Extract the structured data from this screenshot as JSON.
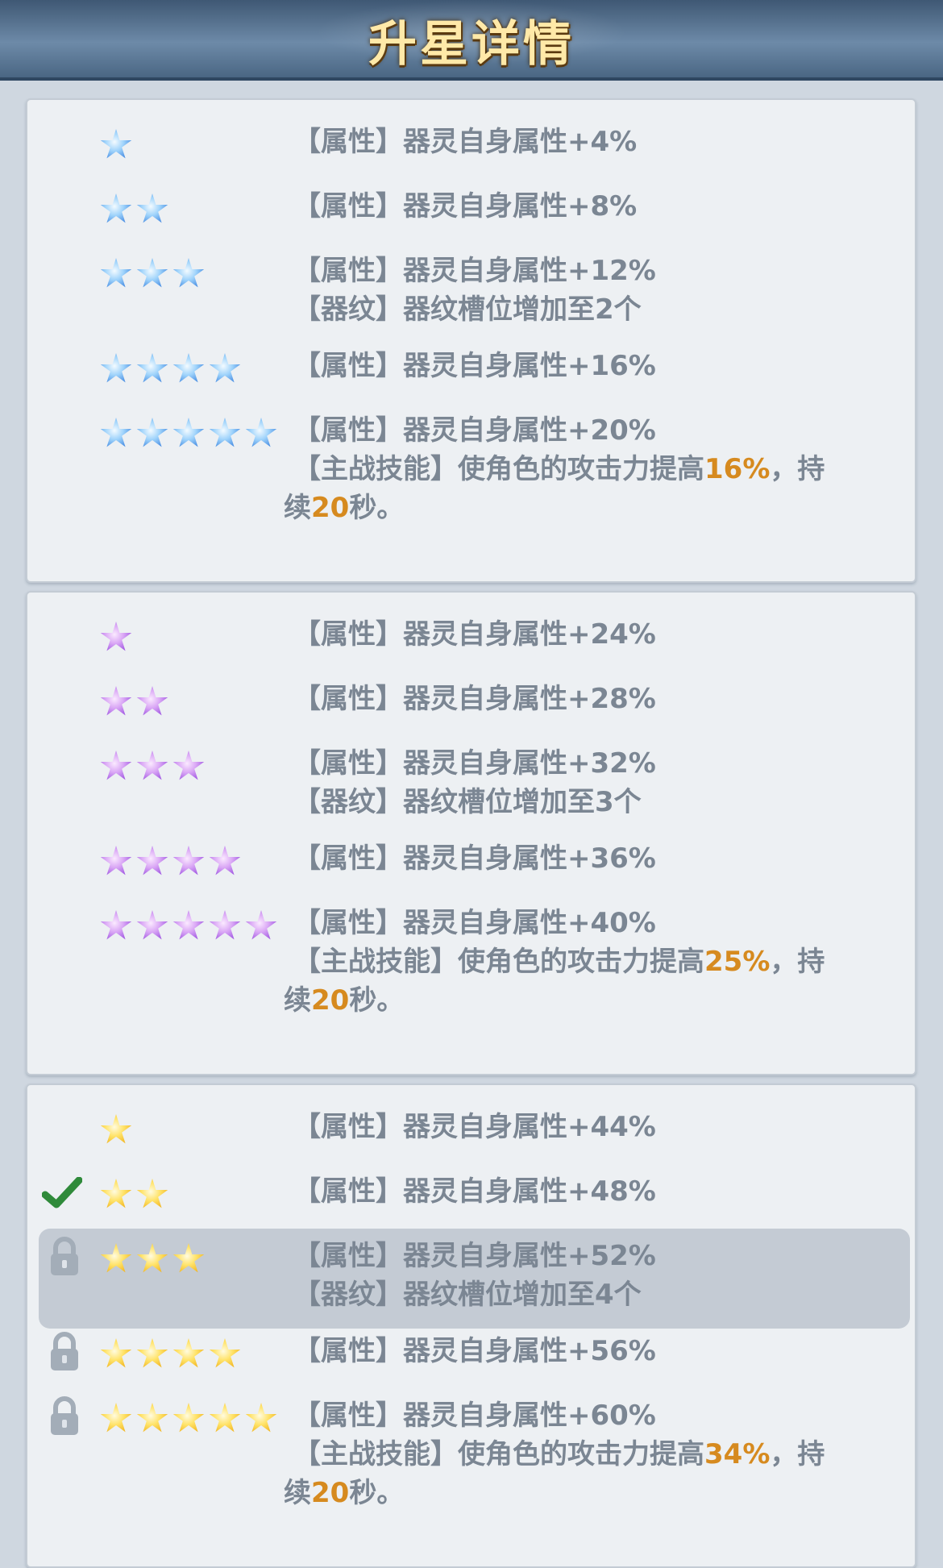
{
  "header": {
    "title": "升星详情"
  },
  "colors": {
    "blue_star": "#4a90e6",
    "purple_star": "#a05ae0",
    "gold_star": "#f2b623",
    "text": "#7b8693",
    "highlight": "#d68a1f",
    "check": "#2f8a3a"
  },
  "panels": [
    {
      "tier": "blue",
      "rows": [
        {
          "stars": 1,
          "lines": [
            "【属性】器灵自身属性+4%"
          ]
        },
        {
          "stars": 2,
          "lines": [
            "【属性】器灵自身属性+8%"
          ]
        },
        {
          "stars": 3,
          "lines": [
            "【属性】器灵自身属性+12%",
            "【器纹】器纹槽位增加至2个"
          ]
        },
        {
          "stars": 4,
          "lines": [
            "【属性】器灵自身属性+16%"
          ]
        },
        {
          "stars": 5,
          "lines": [
            "【属性】器灵自身属性+20%"
          ],
          "skill": {
            "prefix": "【主战技能】使角色的攻击力提高",
            "pct": "16%",
            "mid": "，持",
            "cont": "续",
            "sec": "20",
            "suffix": "秒。"
          }
        }
      ]
    },
    {
      "tier": "purple",
      "rows": [
        {
          "stars": 1,
          "lines": [
            "【属性】器灵自身属性+24%"
          ]
        },
        {
          "stars": 2,
          "lines": [
            "【属性】器灵自身属性+28%"
          ]
        },
        {
          "stars": 3,
          "lines": [
            "【属性】器灵自身属性+32%",
            "【器纹】器纹槽位增加至3个"
          ]
        },
        {
          "stars": 4,
          "lines": [
            "【属性】器灵自身属性+36%"
          ]
        },
        {
          "stars": 5,
          "lines": [
            "【属性】器灵自身属性+40%"
          ],
          "skill": {
            "prefix": "【主战技能】使角色的攻击力提高",
            "pct": "25%",
            "mid": "，持",
            "cont": "续",
            "sec": "20",
            "suffix": "秒。"
          }
        }
      ]
    },
    {
      "tier": "gold",
      "rows": [
        {
          "stars": 1,
          "state": "none",
          "lines": [
            "【属性】器灵自身属性+44%"
          ]
        },
        {
          "stars": 2,
          "state": "current",
          "lines": [
            "【属性】器灵自身属性+48%"
          ]
        },
        {
          "stars": 3,
          "state": "locked-next",
          "lines": [
            "【属性】器灵自身属性+52%",
            "【器纹】器纹槽位增加至4个"
          ]
        },
        {
          "stars": 4,
          "state": "locked",
          "lines": [
            "【属性】器灵自身属性+56%"
          ]
        },
        {
          "stars": 5,
          "state": "locked",
          "lines": [
            "【属性】器灵自身属性+60%"
          ],
          "skill": {
            "prefix": "【主战技能】使角色的攻击力提高",
            "pct": "34%",
            "mid": "，持",
            "cont": "续",
            "sec": "20",
            "suffix": "秒。"
          }
        }
      ]
    }
  ]
}
